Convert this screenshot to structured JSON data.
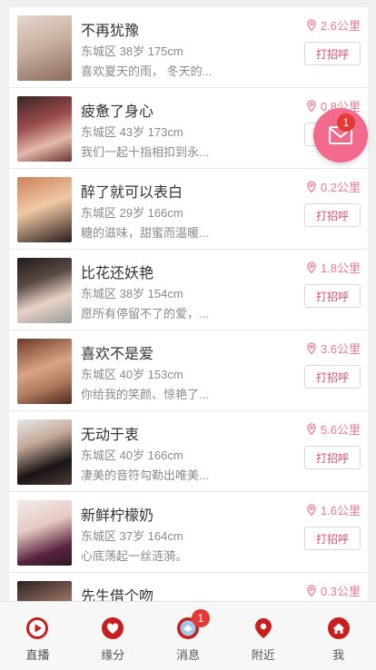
{
  "people": [
    {
      "name": "不再犹豫",
      "meta": "东城区 38岁 175cm",
      "bio": "喜欢夏天的雨， 冬天的...",
      "distance": "2.6公里",
      "greet_label": "打招呼"
    },
    {
      "name": "疲惫了身心",
      "meta": "东城区 43岁 173cm",
      "bio": "我们一起十指相扣到永...",
      "distance": "0.8公里",
      "greet_label": "打招呼"
    },
    {
      "name": "醉了就可以表白",
      "meta": "东城区 29岁 166cm",
      "bio": "糖的滋味，甜蜜而温暖...",
      "distance": "0.2公里",
      "greet_label": "打招呼"
    },
    {
      "name": "比花还妖艳",
      "meta": "东城区 38岁 154cm",
      "bio": "愿所有停留不了的爱，...",
      "distance": "1.8公里",
      "greet_label": "打招呼"
    },
    {
      "name": "喜欢不是爱",
      "meta": "东城区 40岁 153cm",
      "bio": "你给我的笑颜、惊艳了...",
      "distance": "3.6公里",
      "greet_label": "打招呼"
    },
    {
      "name": "无动于衷",
      "meta": "东城区 40岁 166cm",
      "bio": "凄美的音符勾勒出唯美...",
      "distance": "5.6公里",
      "greet_label": "打招呼"
    },
    {
      "name": "新鲜柠檬奶",
      "meta": "东城区 37岁 164cm",
      "bio": "心底荡起一丝涟漪。",
      "distance": "1.6公里",
      "greet_label": "打招呼"
    },
    {
      "name": "先生借个吻",
      "meta": "",
      "bio": "",
      "distance": "0.3公里",
      "greet_label": ""
    }
  ],
  "fab": {
    "badge": "1"
  },
  "tabs": [
    {
      "label": "直播",
      "icon": "play-icon"
    },
    {
      "label": "缘分",
      "icon": "heart-icon"
    },
    {
      "label": "消息",
      "icon": "message-icon",
      "badge": "1"
    },
    {
      "label": "附近",
      "icon": "location-pin-icon"
    },
    {
      "label": "我",
      "icon": "home-icon"
    }
  ],
  "colors": {
    "accent": "#f36a8c",
    "tab_icon": "#c81e1e",
    "badge": "#e53935",
    "distance": "#f07a8e"
  }
}
